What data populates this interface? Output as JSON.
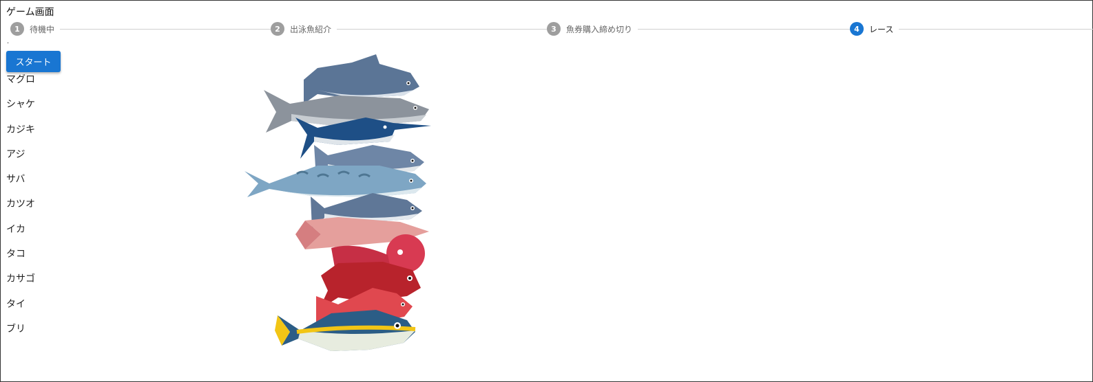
{
  "page": {
    "title": "ゲーム画面"
  },
  "stepper": {
    "steps": [
      {
        "number": "1",
        "label": "待機中",
        "active": false
      },
      {
        "number": "2",
        "label": "出泳魚紹介",
        "active": false
      },
      {
        "number": "3",
        "label": "魚券購入締め切り",
        "active": false
      },
      {
        "number": "4",
        "label": "レース",
        "active": true
      }
    ],
    "colors": {
      "active": "#1976d2",
      "inactive": "#9e9e9e",
      "connector": "#cfcfcf"
    }
  },
  "status_dot": ".",
  "start_button": {
    "label": "スタート",
    "color": "#1976d2"
  },
  "fish": [
    {
      "name": "マグロ",
      "icon": "tuna-icon"
    },
    {
      "name": "シャケ",
      "icon": "salmon-icon"
    },
    {
      "name": "カジキ",
      "icon": "marlin-icon"
    },
    {
      "name": "アジ",
      "icon": "horse-mackerel-icon"
    },
    {
      "name": "サバ",
      "icon": "mackerel-icon"
    },
    {
      "name": "カツオ",
      "icon": "bonito-icon"
    },
    {
      "name": "イカ",
      "icon": "squid-icon"
    },
    {
      "name": "タコ",
      "icon": "octopus-icon"
    },
    {
      "name": "カサゴ",
      "icon": "scorpionfish-icon"
    },
    {
      "name": "タイ",
      "icon": "sea-bream-icon"
    },
    {
      "name": "ブリ",
      "icon": "yellowtail-icon"
    }
  ]
}
